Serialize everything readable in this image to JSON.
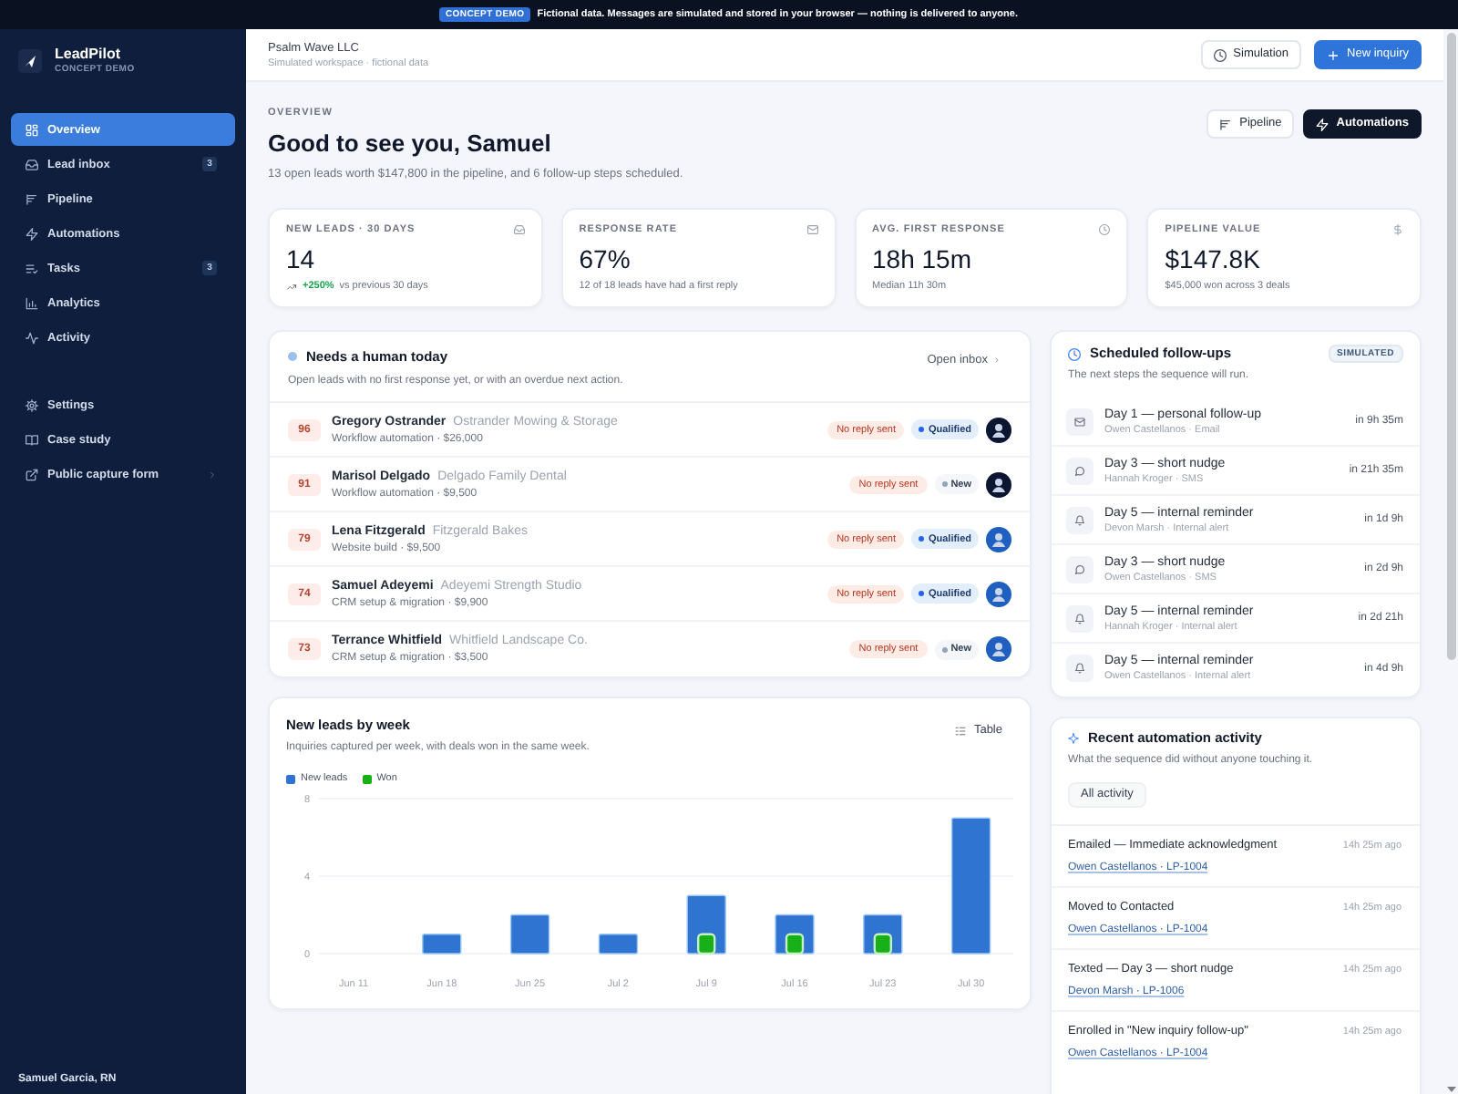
{
  "banner": {
    "badge": "CONCEPT DEMO",
    "text": "Fictional data. Messages are simulated and stored in your browser — nothing is delivered to anyone."
  },
  "sidebar": {
    "brand": {
      "name": "LeadPilot",
      "tagline": "CONCEPT DEMO"
    },
    "nav": [
      {
        "label": "Overview",
        "selected": true
      },
      {
        "label": "Lead inbox",
        "selected": false,
        "badge": "3"
      },
      {
        "label": "Pipeline",
        "selected": false
      },
      {
        "label": "Automations",
        "selected": false
      },
      {
        "label": "Tasks",
        "selected": false,
        "badge": "3"
      },
      {
        "label": "Analytics",
        "selected": false
      },
      {
        "label": "Activity",
        "selected": false
      }
    ],
    "secondary_nav": [
      {
        "label": "Settings",
        "kind": "page",
        "selected": false
      },
      {
        "label": "Case study",
        "kind": "page",
        "selected": false
      },
      {
        "label": "Public capture form",
        "kind": "external",
        "selected": false
      }
    ],
    "user": "Samuel Garcia, RN"
  },
  "top_bar": {
    "workspace": "Psalm Wave LLC",
    "subtitle": "Simulated workspace · fictional data",
    "buttons": [
      {
        "label": "Simulation",
        "kind": "outline"
      },
      {
        "label": "New inquiry",
        "kind": "primary"
      }
    ]
  },
  "page_header": {
    "eyebrow": "OVERVIEW",
    "title": "Good to see you, Samuel",
    "subtitle": "13 open leads worth $147,800 in the pipeline, and 6 follow-up steps scheduled.",
    "buttons": [
      {
        "label": "Pipeline",
        "kind": "outline"
      },
      {
        "label": "Automations",
        "kind": "dark"
      }
    ]
  },
  "stats": [
    {
      "label": "NEW LEADS · 30 DAYS",
      "value": "14",
      "trend": "+250%",
      "note": "vs previous 30 days"
    },
    {
      "label": "RESPONSE RATE",
      "value": "67%",
      "note": "12 of 18 leads have had a first reply"
    },
    {
      "label": "AVG. FIRST RESPONSE",
      "value": "18h 15m",
      "note": "Median 11h 30m"
    },
    {
      "label": "PIPELINE VALUE",
      "value": "$147.8K",
      "note": "$45,000 won across 3 deals"
    }
  ],
  "needs_human": {
    "title": "Needs a human today",
    "subtitle": "Open leads with no first response yet, or with an overdue next action.",
    "link": "Open inbox",
    "leads": [
      {
        "score": "96",
        "name": "Gregory Ostrander",
        "company": "Ostrander Mowing & Storage",
        "detail": "Workflow automation · $26,000",
        "flag": "No reply sent",
        "status": "Qualified",
        "kind": "qualified",
        "avatar": {
          "color": "#0c1630"
        }
      },
      {
        "score": "91",
        "name": "Marisol Delgado",
        "company": "Delgado Family Dental",
        "detail": "Workflow automation · $9,500",
        "flag": "No reply sent",
        "status": "New",
        "kind": "new",
        "avatar": {
          "color": "#0c1630"
        }
      },
      {
        "score": "79",
        "name": "Lena Fitzgerald",
        "company": "Fitzgerald Bakes",
        "detail": "Website build · $9,500",
        "flag": "No reply sent",
        "status": "Qualified",
        "kind": "qualified",
        "avatar": {
          "color": "#1f5fbf"
        }
      },
      {
        "score": "74",
        "name": "Samuel Adeyemi",
        "company": "Adeyemi Strength Studio",
        "detail": "CRM setup & migration · $9,900",
        "flag": "No reply sent",
        "status": "Qualified",
        "kind": "qualified",
        "avatar": {
          "color": "#1f5fbf"
        }
      },
      {
        "score": "73",
        "name": "Terrance Whitfield",
        "company": "Whitfield Landscape Co.",
        "detail": "CRM setup & migration · $3,500",
        "flag": "No reply sent",
        "status": "New",
        "kind": "new",
        "avatar": {
          "color": "#1f5fbf"
        }
      }
    ]
  },
  "followups": {
    "title": "Scheduled follow-ups",
    "badge": "SIMULATED",
    "subtitle": "The next steps the sequence will run.",
    "items": [
      {
        "kind": "email",
        "title": "Day 1 — personal follow-up",
        "detail": "Owen Castellanos · Email",
        "due": "in 9h 35m"
      },
      {
        "kind": "sms",
        "title": "Day 3 — short nudge",
        "detail": "Hannah Kroger · SMS",
        "due": "in 21h 35m"
      },
      {
        "kind": "alert",
        "title": "Day 5 — internal reminder",
        "detail": "Devon Marsh · Internal alert",
        "due": "in 1d 9h"
      },
      {
        "kind": "sms",
        "title": "Day 3 — short nudge",
        "detail": "Owen Castellanos · SMS",
        "due": "in 2d 9h"
      },
      {
        "kind": "alert",
        "title": "Day 5 — internal reminder",
        "detail": "Hannah Kroger · Internal alert",
        "due": "in 2d 21h"
      },
      {
        "kind": "alert",
        "title": "Day 5 — internal reminder",
        "detail": "Owen Castellanos · Internal alert",
        "due": "in 4d 9h"
      }
    ]
  },
  "leads_chart": {
    "title": "New leads by week",
    "subtitle": "Inquiries captured per week, with deals won in the same week.",
    "button": "Table",
    "chart_data": {
      "type": "bar",
      "categories": [
        "Jun 11",
        "Jun 18",
        "Jun 25",
        "Jul 2",
        "Jul 9",
        "Jul 16",
        "Jul 23",
        "Jul 30"
      ],
      "series": [
        {
          "name": "New leads",
          "color": "#2f74d0",
          "values": [
            0,
            1,
            2,
            1,
            3,
            2,
            2,
            7
          ]
        },
        {
          "name": "Won",
          "color": "#18b018",
          "values": [
            0,
            0,
            0,
            0,
            1,
            1,
            1,
            0
          ]
        }
      ],
      "ylim": [
        0,
        8
      ],
      "yticks": [
        0,
        4,
        8
      ]
    }
  },
  "activity": {
    "title": "Recent automation activity",
    "subtitle": "What the sequence did without anyone touching it.",
    "filter": "All activity",
    "items": [
      {
        "text": "Emailed — Immediate acknowledgment",
        "link": "Owen Castellanos · LP-1004",
        "time": "14h 25m ago"
      },
      {
        "text": "Moved to Contacted",
        "link": "Owen Castellanos · LP-1004",
        "time": "14h 25m ago"
      },
      {
        "text": "Texted — Day 3 — short nudge",
        "link": "Devon Marsh · LP-1006",
        "time": "14h 25m ago"
      },
      {
        "text": "Enrolled in \"New inquiry follow-up\"",
        "link": "Owen Castellanos · LP-1004",
        "time": "14h 25m ago"
      }
    ]
  }
}
